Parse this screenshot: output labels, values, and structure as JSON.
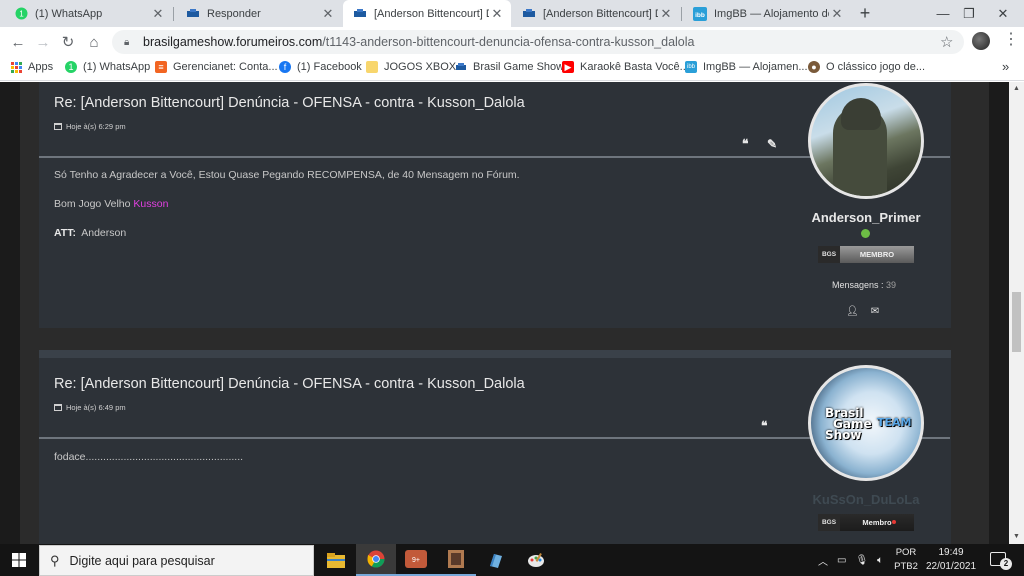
{
  "browser": {
    "tabs": [
      {
        "title": "(1) WhatsApp",
        "icon": "whatsapp-icon",
        "active": false
      },
      {
        "title": "Responder",
        "icon": "forum-icon",
        "active": false
      },
      {
        "title": "[Anderson Bittencourt] Denúncia",
        "icon": "forum-icon",
        "active": true
      },
      {
        "title": "[Anderson Bittencourt] Denúncia",
        "icon": "forum-icon",
        "active": false
      },
      {
        "title": "ImgBB — Alojamento de ima",
        "icon": "imgbb-icon",
        "active": false
      }
    ],
    "close_glyph": "✕",
    "new_tab_glyph": "+",
    "window_controls": {
      "minimize": "—",
      "restore": "❐",
      "close": "✕"
    },
    "address": {
      "domain": "brasilgameshow.forumeiros.com",
      "path": "/t1143-anderson-bittencourt-denuncia-ofensa-contra-kusson_dalola"
    },
    "bookmarks": [
      {
        "label": "Apps",
        "icon": "apps-grid-icon"
      },
      {
        "label": "(1) WhatsApp",
        "icon": "whatsapp-icon"
      },
      {
        "label": "Gerencianet: Conta...",
        "icon": "gerencianet-icon"
      },
      {
        "label": "(1) Facebook",
        "icon": "facebook-icon"
      },
      {
        "label": "JOGOS XBOX",
        "icon": "folder-icon"
      },
      {
        "label": "Brasil Game Show",
        "icon": "forum-icon"
      },
      {
        "label": "Karaokê Basta Você...",
        "icon": "youtube-icon"
      },
      {
        "label": "ImgBB — Alojamen...",
        "icon": "imgbb-icon"
      },
      {
        "label": "O clássico jogo de...",
        "icon": "game-icon"
      }
    ],
    "more_bookmarks": "»"
  },
  "posts": [
    {
      "title": "Re: [Anderson Bittencourt] Denúncia - OFENSA - contra - Kusson_Dalola",
      "date": "Hoje à(s) 6:29 pm",
      "body_line1": "Só Tenho a Agradecer a Você, Estou Quase Pegando RECOMPENSA, de 40 Mensagem no Fórum.",
      "body_line2_prefix": "Bom Jogo Velho ",
      "body_line2_name": "Kusson",
      "body_line3_label": "ATT:",
      "body_line3_value": "Anderson",
      "author": {
        "name": "Anderson_Primer",
        "online": true,
        "rank_tag": "BGS",
        "rank_label": "MEMBRO",
        "messages_label": "Mensagens :",
        "messages_count": "39"
      }
    },
    {
      "title": "Re: [Anderson Bittencourt] Denúncia - OFENSA - contra - Kusson_Dalola",
      "date": "Hoje à(s) 6:49 pm",
      "body_line1": "fodace......................................................",
      "author": {
        "name": "KuSsOn_DuLoLa",
        "rank_tag": "BGS",
        "rank_label": "Membro",
        "avatar_text": [
          "Brasil",
          "Game",
          "Show",
          "TEAM"
        ]
      }
    }
  ],
  "taskbar": {
    "search_placeholder": "Digite aqui para pesquisar",
    "lang_line1": "POR",
    "lang_line2": "PTB2",
    "time": "19:49",
    "date": "22/01/2021",
    "notification_count": "2"
  },
  "colors": {
    "accent_link": "#e040e0",
    "online": "#6dbd45",
    "post_bg": "#2d3238",
    "page_bg": "#2b2b2b"
  }
}
